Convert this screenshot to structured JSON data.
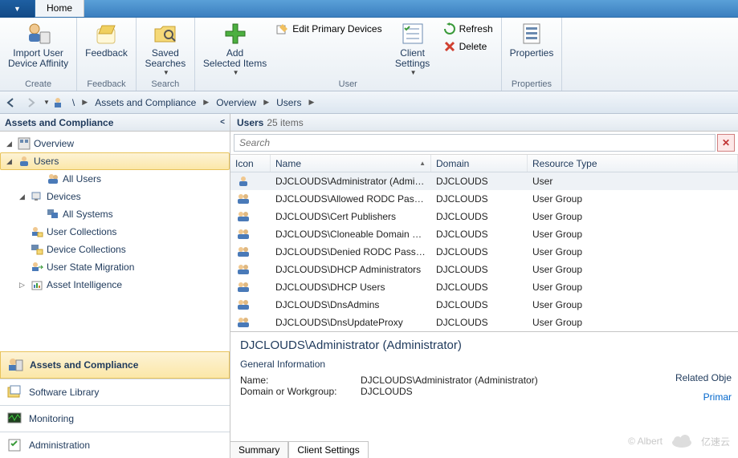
{
  "tabs": {
    "home": "Home"
  },
  "ribbon": {
    "create": {
      "title": "Create",
      "importUserDeviceAffinity": "Import User\nDevice Affinity"
    },
    "feedback": {
      "title": "Feedback",
      "feedback": "Feedback"
    },
    "search": {
      "title": "Search",
      "savedSearches": "Saved\nSearches"
    },
    "user": {
      "title": "User",
      "addSelectedItems": "Add\nSelected Items",
      "editPrimaryDevices": "Edit Primary Devices",
      "clientSettings": "Client\nSettings",
      "refresh": "Refresh",
      "delete": "Delete"
    },
    "properties": {
      "title": "Properties",
      "properties": "Properties"
    }
  },
  "breadcrumb": {
    "root": "\\",
    "items": [
      "Assets and Compliance",
      "Overview",
      "Users"
    ]
  },
  "leftPanel": {
    "title": "Assets and Compliance",
    "tree": {
      "overview": "Overview",
      "users": "Users",
      "allUsers": "All Users",
      "devices": "Devices",
      "allSystems": "All Systems",
      "userCollections": "User Collections",
      "deviceCollections": "Device Collections",
      "userStateMigration": "User State Migration",
      "assetIntelligence": "Asset Intelligence"
    },
    "wunderbar": {
      "assets": "Assets and Compliance",
      "software": "Software Library",
      "monitoring": "Monitoring",
      "administration": "Administration"
    }
  },
  "list": {
    "title": "Users",
    "count": "25 items",
    "searchPlaceholder": "Search",
    "columns": {
      "icon": "Icon",
      "name": "Name",
      "domain": "Domain",
      "resourceType": "Resource Type"
    },
    "rows": [
      {
        "name": "DJCLOUDS\\Administrator (Admin...",
        "domain": "DJCLOUDS",
        "rt": "User",
        "type": "user"
      },
      {
        "name": "DJCLOUDS\\Allowed RODC Passw...",
        "domain": "DJCLOUDS",
        "rt": "User Group",
        "type": "group"
      },
      {
        "name": "DJCLOUDS\\Cert Publishers",
        "domain": "DJCLOUDS",
        "rt": "User Group",
        "type": "group"
      },
      {
        "name": "DJCLOUDS\\Cloneable Domain Co...",
        "domain": "DJCLOUDS",
        "rt": "User Group",
        "type": "group"
      },
      {
        "name": "DJCLOUDS\\Denied RODC Passwo...",
        "domain": "DJCLOUDS",
        "rt": "User Group",
        "type": "group"
      },
      {
        "name": "DJCLOUDS\\DHCP Administrators",
        "domain": "DJCLOUDS",
        "rt": "User Group",
        "type": "group"
      },
      {
        "name": "DJCLOUDS\\DHCP Users",
        "domain": "DJCLOUDS",
        "rt": "User Group",
        "type": "group"
      },
      {
        "name": "DJCLOUDS\\DnsAdmins",
        "domain": "DJCLOUDS",
        "rt": "User Group",
        "type": "group"
      },
      {
        "name": "DJCLOUDS\\DnsUpdateProxy",
        "domain": "DJCLOUDS",
        "rt": "User Group",
        "type": "group"
      }
    ]
  },
  "details": {
    "title": "DJCLOUDS\\Administrator (Administrator)",
    "generalInfo": "General Information",
    "nameLabel": "Name:",
    "nameValue": "DJCLOUDS\\Administrator (Administrator)",
    "domainLabel": "Domain or Workgroup:",
    "domainValue": "DJCLOUDS",
    "relatedTitle": "Related Obje",
    "primaryLink": "Primar",
    "tabs": {
      "summary": "Summary",
      "clientSettings": "Client Settings"
    }
  },
  "watermark": {
    "author": "© Albert",
    "brand": "亿速云"
  }
}
